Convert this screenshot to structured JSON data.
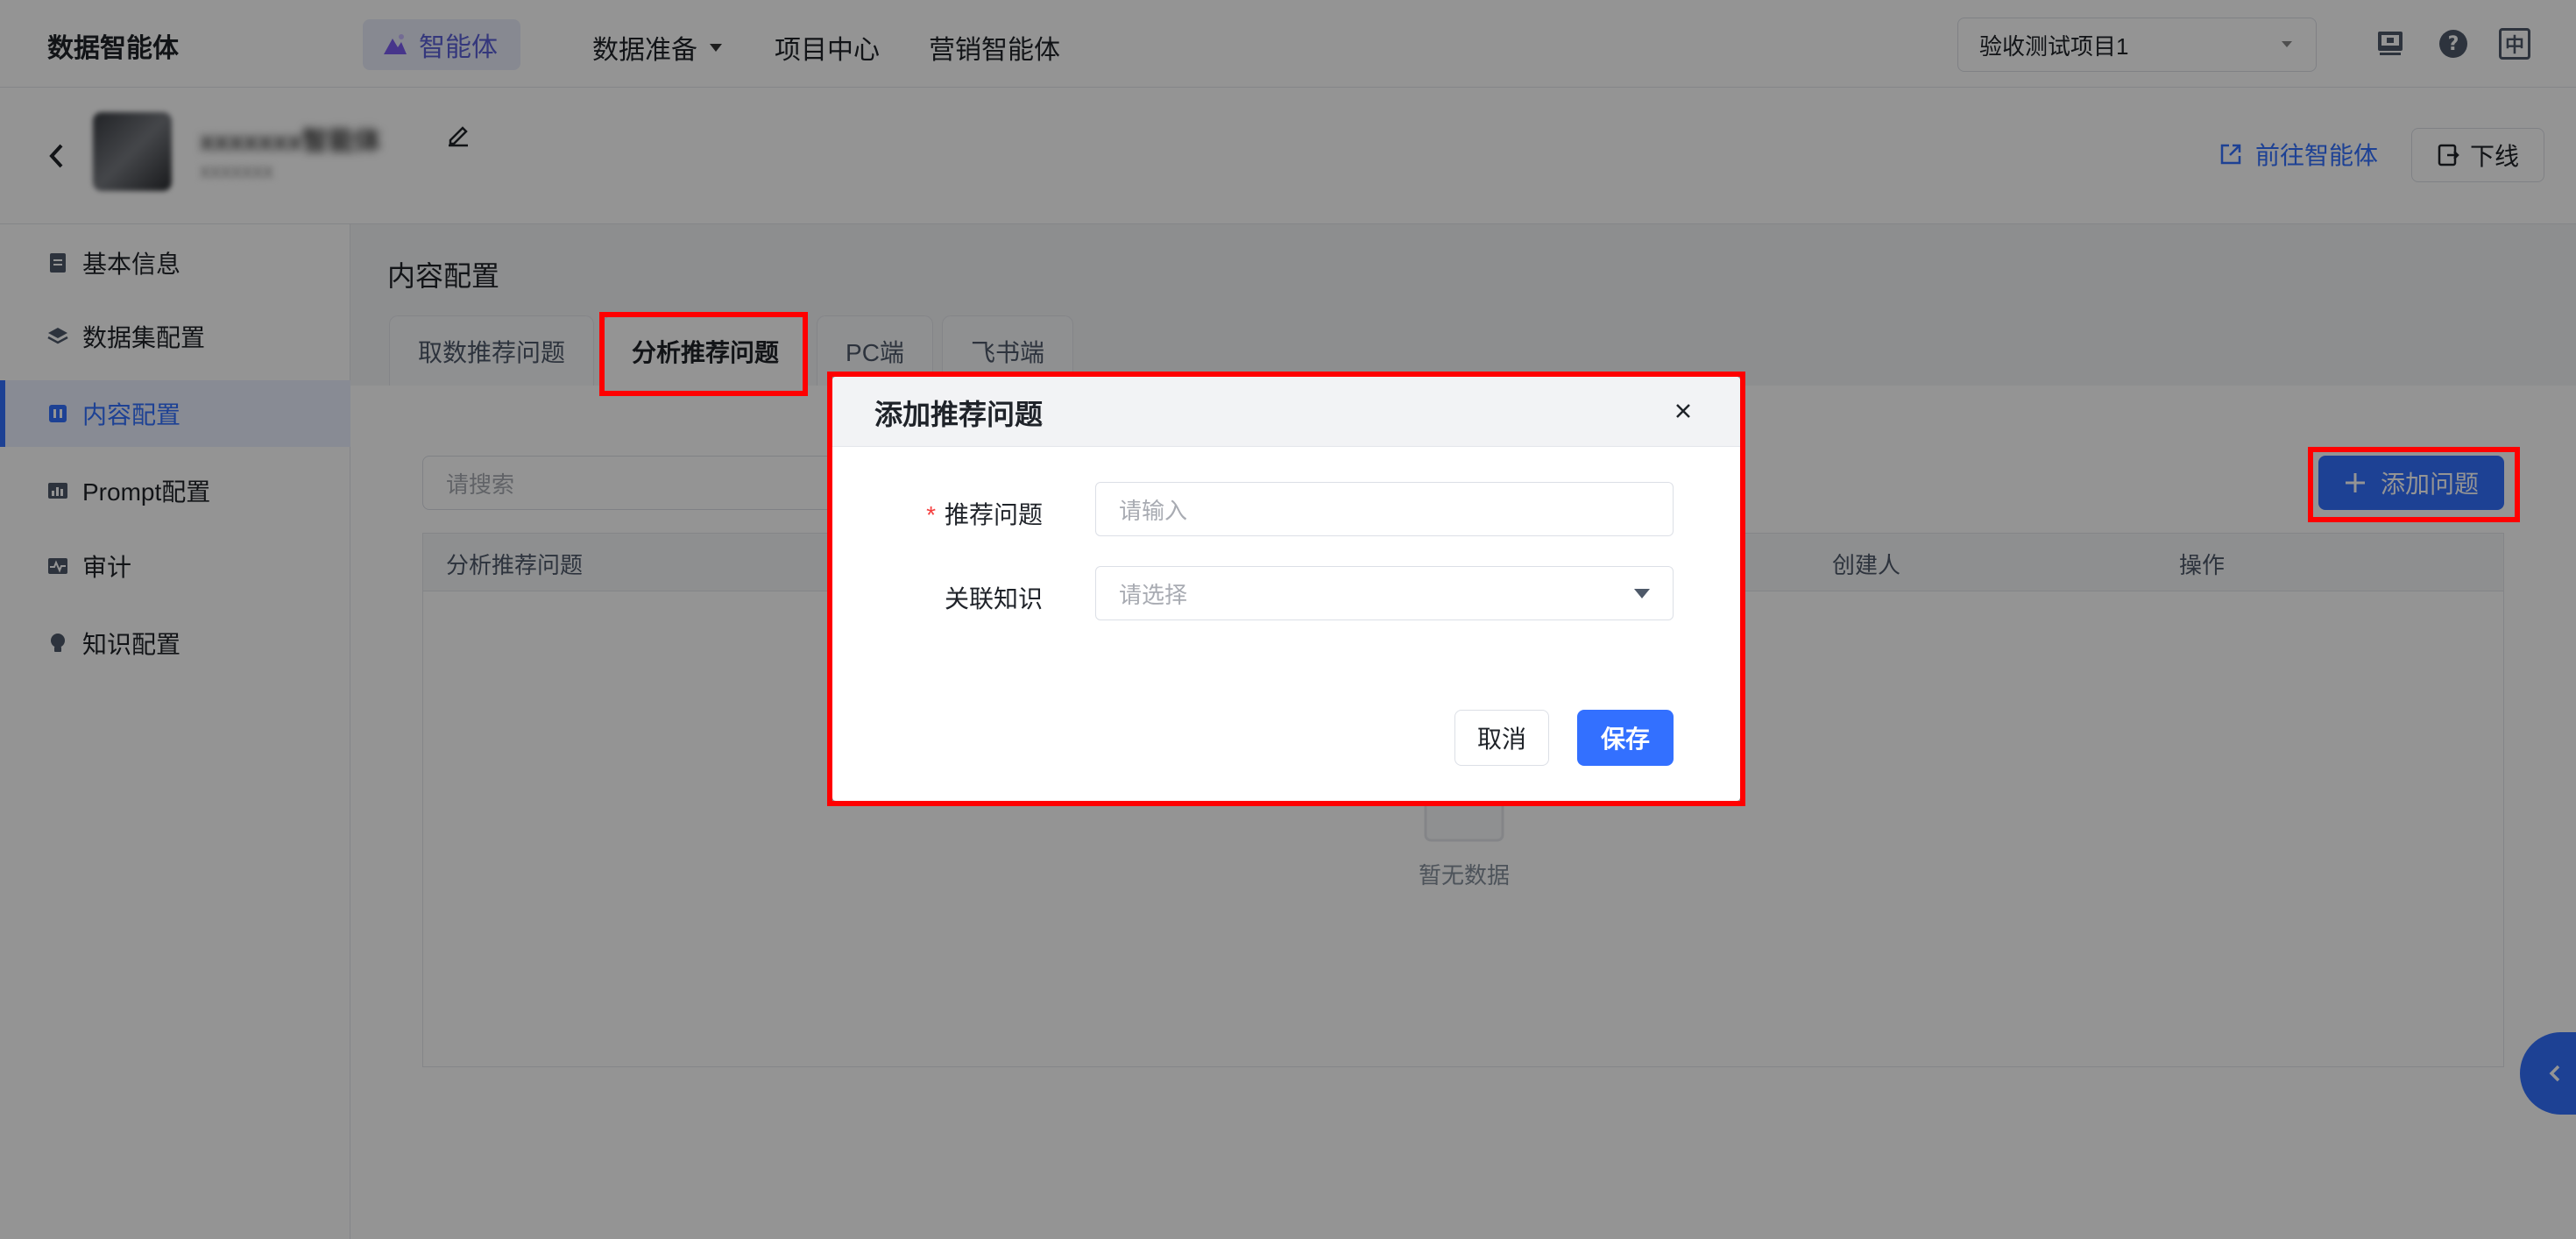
{
  "topnav": {
    "brand": "数据智能体",
    "active_item": "智能体",
    "items": [
      "数据准备",
      "项目中心",
      "营销智能体"
    ],
    "project_select": "验收测试项目1",
    "icons": [
      "monitor-icon",
      "help-icon",
      "language-icon"
    ],
    "lang_label": "中"
  },
  "header": {
    "agent_name": "xxxxxxx智能体",
    "agent_sub": "xxxxxxx",
    "goto_label": "前往智能体",
    "offline_label": "下线"
  },
  "sidebar": {
    "items": [
      {
        "label": "基本信息",
        "icon": "doc-icon"
      },
      {
        "label": "数据集配置",
        "icon": "layers-icon"
      },
      {
        "label": "内容配置",
        "icon": "content-icon",
        "active": true
      },
      {
        "label": "Prompt配置",
        "icon": "chart-icon"
      },
      {
        "label": "审计",
        "icon": "pulse-icon"
      },
      {
        "label": "知识配置",
        "icon": "bulb-icon"
      }
    ]
  },
  "main": {
    "section_title": "内容配置",
    "tabs": [
      "取数推荐问题",
      "分析推荐问题",
      "PC端",
      "飞书端"
    ],
    "active_tab": 1,
    "search_placeholder": "请搜索",
    "add_button": "添加问题",
    "columns": [
      "分析推荐问题",
      "创建人",
      "操作"
    ],
    "empty_text": "暂无数据"
  },
  "modal": {
    "title": "添加推荐问题",
    "fields": [
      {
        "label": "推荐问题",
        "required": true,
        "placeholder": "请输入"
      },
      {
        "label": "关联知识",
        "required": false,
        "placeholder": "请选择"
      }
    ],
    "required_mark": "*",
    "cancel": "取消",
    "save": "保存"
  },
  "colors": {
    "primary": "#3370ff",
    "highlight": "#ff0000",
    "mask": "rgba(0,0,0,0.42)"
  }
}
